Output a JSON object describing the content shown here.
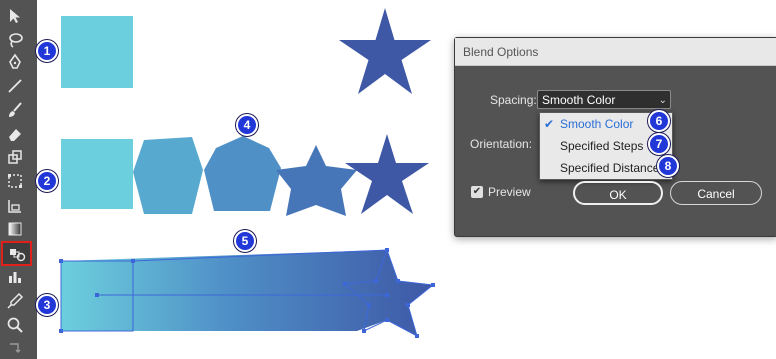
{
  "colors": {
    "toolbar": "#535353",
    "highlight_border": "#e0201b",
    "light_blue": "#6ccfdd",
    "mid_blue": "#5295c5",
    "dark_blue": "#3e58a6",
    "badge": "#2237d8",
    "selection": "#3d67d9"
  },
  "toolbar": {
    "tools": [
      "selection-arrow-icon",
      "lasso-icon",
      "pen-icon",
      "line-segment-icon",
      "paintbrush-icon",
      "eraser-icon",
      "scale-icon",
      "free-transform-icon",
      "chart-table-icon",
      "gradient-icon",
      "blend-tool-icon",
      "column-graph-icon",
      "eyedropper-icon",
      "zoom-icon"
    ],
    "selected_tool": "blend-tool-icon"
  },
  "badges": {
    "b1": "1",
    "b2": "2",
    "b3": "3",
    "b4": "4",
    "b5": "5",
    "b6": "6",
    "b7": "7",
    "b8": "8"
  },
  "dialog": {
    "title": "Blend Options",
    "spacing_label": "Spacing:",
    "spacing_value": "Smooth Color",
    "orientation_label": "Orientation:",
    "menu_items": [
      "Smooth Color",
      "Specified Steps",
      "Specified Distance"
    ],
    "menu_selected": "Smooth Color",
    "preview_label": "Preview",
    "preview_checked": true,
    "ok_label": "OK",
    "cancel_label": "Cancel"
  }
}
